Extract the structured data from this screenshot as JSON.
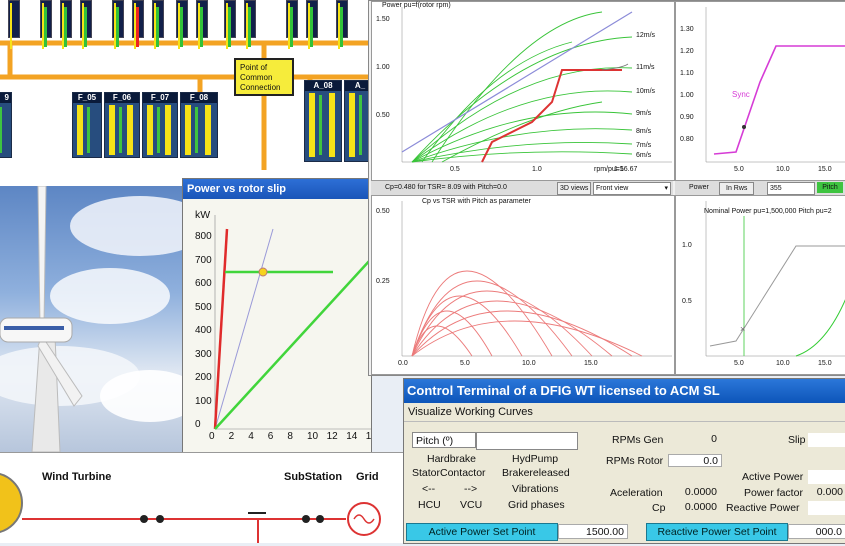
{
  "farm": {
    "pcc_label": "Point of Common Connection",
    "cluster_labels": [
      "F_05",
      "F_06",
      "F_07",
      "F_08",
      "A_08",
      "A_",
      "9"
    ]
  },
  "slip_window": {
    "title": "Power vs rotor slip",
    "y_unit": "kW",
    "y_ticks": [
      "800",
      "700",
      "600",
      "500",
      "400",
      "300",
      "200",
      "100",
      "0"
    ],
    "x_ticks": [
      "0",
      "2",
      "4",
      "6",
      "8",
      "10",
      "12",
      "14",
      "1"
    ]
  },
  "curves": {
    "top_left": {
      "title": "Power pu=f(rotor rpm)",
      "speed_labels": [
        "12m/s",
        "11m/s",
        "10m/s",
        "9m/s",
        "8m/s",
        "7m/s",
        "6m/s"
      ],
      "y_ticks": [
        "1.50",
        "1.00",
        "0.50"
      ],
      "x_ticks": [
        "0.5",
        "1.0",
        "1.5"
      ],
      "footer": "rpm/pu=16.67"
    },
    "top_right": {
      "y_ticks": [
        "1.30",
        "1.20",
        "1.10",
        "1.00",
        "0.90",
        "0.80"
      ],
      "x_ticks": [
        "5.0",
        "10.0",
        "15.0"
      ],
      "sync_label": "Sync"
    },
    "cp_toolbar": {
      "text": "Cp=0.480 for TSR= 8.09  with Pitch=0.0",
      "views_button": "3D views",
      "view_select": "Front view"
    },
    "cp": {
      "title": "Cp vs TSR with Pitch as parameter",
      "y_ticks": [
        "0.50",
        "0.25"
      ],
      "x_ticks": [
        "0.0",
        "5.0",
        "10.0",
        "15.0"
      ]
    },
    "right_toolbar": {
      "power_label": "Power",
      "rpm_label": "In  Rws",
      "rpm_value": "355",
      "pitch_label": "Pitch"
    },
    "bottom_right": {
      "title": "Nominal Power pu=1,500,000   Pitch pu=2",
      "y_ticks": [
        "1.0",
        "0.5"
      ],
      "x_ticks": [
        "5.0",
        "10.0",
        "15.0"
      ]
    }
  },
  "sld": {
    "wind_turbine": "Wind Turbine",
    "substation": "SubStation",
    "grid": "Grid"
  },
  "control": {
    "title": "Control Terminal of a DFIG WT licensed to ACM SL",
    "menu": "Visualize Working Curves",
    "pitch_button": "Pitch (º)",
    "buttons": [
      [
        "Hardbrake",
        "HydPump"
      ],
      [
        "StatorContactor",
        "Brakereleased"
      ],
      [
        "<--",
        "-->",
        "Vibrations"
      ],
      [
        "HCU",
        "VCU",
        "Grid phases"
      ]
    ],
    "rpm_gen_label": "RPMs Gen",
    "rpm_gen_value": "0",
    "slip_label": "Slip",
    "rpm_rotor_label": "RPMs Rotor",
    "rpm_rotor_value": "0.0",
    "active_power_label": "Active Power",
    "acceleration_label": "Aceleration",
    "acceleration_value": "0.0000",
    "power_factor_label": "Power factor",
    "power_factor_value": "0.000",
    "cp_label": "Cp",
    "cp_value": "0.0000",
    "reactive_power_label": "Reactive Power",
    "active_setpoint_label": "Active Power Set Point",
    "active_setpoint_value": "1500.00",
    "reactive_setpoint_label": "Reactive Power Set Point",
    "reactive_setpoint_value": "000.0"
  }
}
